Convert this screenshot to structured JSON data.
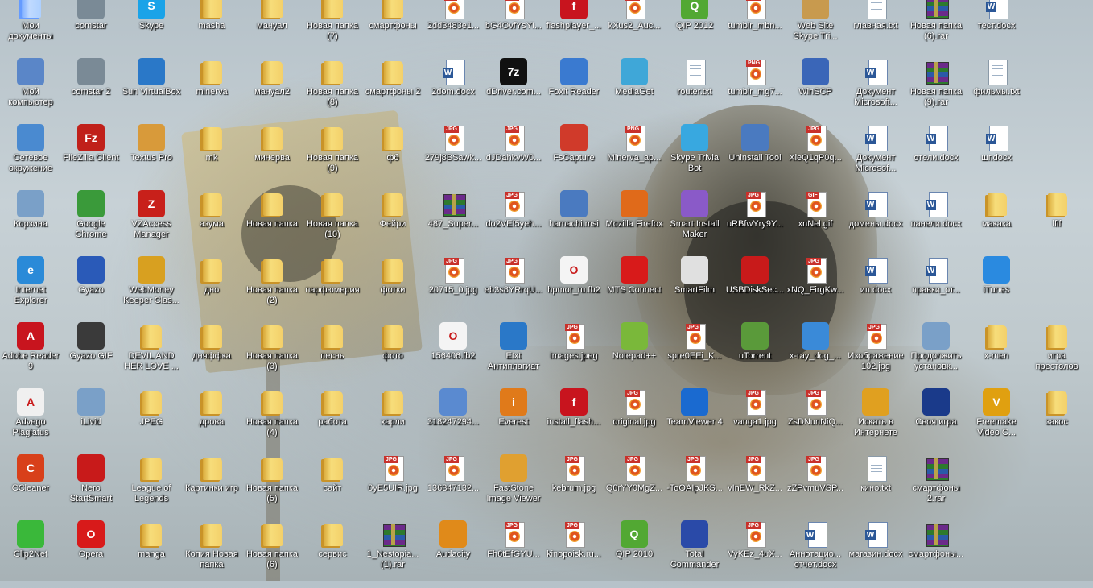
{
  "desktop": {
    "items": [
      {
        "label": "Мои документы",
        "icon": "my-documents-icon",
        "glyph": "folder",
        "color": "#4a7fd4"
      },
      {
        "label": "comstar",
        "icon": "shortcut-pc-icon",
        "glyph": "app",
        "color": "#7a8a96"
      },
      {
        "label": "Skype",
        "icon": "skype-icon",
        "glyph": "app",
        "color": "#1aa3e8",
        "sym": "S"
      },
      {
        "label": "masha",
        "icon": "folder-icon",
        "glyph": "folder"
      },
      {
        "label": "мануал",
        "icon": "folder-icon",
        "glyph": "folder"
      },
      {
        "label": "Новая папка (7)",
        "icon": "folder-icon",
        "glyph": "folder"
      },
      {
        "label": "смартфоны",
        "icon": "folder-icon",
        "glyph": "folder"
      },
      {
        "label": "2dd3483e1...",
        "icon": "gif-file-icon",
        "glyph": "img",
        "tag": "GIF"
      },
      {
        "label": "bG4OvfYsYI...",
        "icon": "jpg-file-icon",
        "glyph": "img",
        "tag": "JPG"
      },
      {
        "label": "flashplayer_...",
        "icon": "flash-icon",
        "glyph": "app",
        "color": "#c8141e",
        "sym": "f"
      },
      {
        "label": "kXus2_Auc...",
        "icon": "jpg-file-icon",
        "glyph": "img",
        "tag": "JPG"
      },
      {
        "label": "QIP 2012",
        "icon": "qip-icon",
        "glyph": "app",
        "color": "#52a833",
        "sym": "Q"
      },
      {
        "label": "tumblr_mbn...",
        "icon": "jpg-file-icon",
        "glyph": "img",
        "tag": "JPG"
      },
      {
        "label": "Web Site Skype Tri...",
        "icon": "package-icon",
        "glyph": "app",
        "color": "#c89a4e"
      },
      {
        "label": "главная.txt",
        "icon": "text-file-icon",
        "glyph": "doc"
      },
      {
        "label": "Новая папка (6).rar",
        "icon": "rar-archive-icon",
        "glyph": "rar"
      },
      {
        "label": "тест.docx",
        "icon": "word-doc-icon",
        "glyph": "word"
      },
      {
        "label": "Мой компьютер",
        "icon": "my-computer-icon",
        "glyph": "app",
        "color": "#5a86c8"
      },
      {
        "label": "comstar 2",
        "icon": "shortcut-pc-icon",
        "glyph": "app",
        "color": "#7a8a96"
      },
      {
        "label": "Sun VirtualBox",
        "icon": "virtualbox-icon",
        "glyph": "app",
        "color": "#2a78c8"
      },
      {
        "label": "minerva",
        "icon": "folder-icon",
        "glyph": "folder"
      },
      {
        "label": "мануал2",
        "icon": "folder-icon",
        "glyph": "folder"
      },
      {
        "label": "Новая папка (8)",
        "icon": "folder-icon",
        "glyph": "folder"
      },
      {
        "label": "смартфоны 2",
        "icon": "folder-icon",
        "glyph": "folder"
      },
      {
        "label": "2dom.docx",
        "icon": "word-doc-icon",
        "glyph": "word"
      },
      {
        "label": "dDriver.com...",
        "icon": "7zip-icon",
        "glyph": "app",
        "color": "#111",
        "sym": "7z"
      },
      {
        "label": "Foxit Reader",
        "icon": "foxit-reader-icon",
        "glyph": "app",
        "color": "#3a7ad0"
      },
      {
        "label": "MediaGet",
        "icon": "mediaget-icon",
        "glyph": "app",
        "color": "#3fa7d8"
      },
      {
        "label": "router.txt",
        "icon": "text-file-icon",
        "glyph": "doc"
      },
      {
        "label": "tumblr_mg7...",
        "icon": "png-file-icon",
        "glyph": "img",
        "tag": "PNG"
      },
      {
        "label": "WinSCP",
        "icon": "winscp-icon",
        "glyph": "app",
        "color": "#3a66b8"
      },
      {
        "label": "Документ Microsoft...",
        "icon": "word-doc-icon",
        "glyph": "word"
      },
      {
        "label": "Новая папка (9).rar",
        "icon": "rar-archive-icon",
        "glyph": "rar"
      },
      {
        "label": "фильмы.txt",
        "icon": "text-file-icon",
        "glyph": "doc"
      },
      {
        "label": "Сетевое окружение",
        "icon": "network-icon",
        "glyph": "app",
        "color": "#4a8ad0"
      },
      {
        "label": "FileZilla Client",
        "icon": "filezilla-icon",
        "glyph": "app",
        "color": "#c0201a",
        "sym": "Fz"
      },
      {
        "label": "Textus Pro",
        "icon": "key-icon",
        "glyph": "app",
        "color": "#d89a3a"
      },
      {
        "label": "mk",
        "icon": "folder-icon",
        "glyph": "folder"
      },
      {
        "label": "минерва",
        "icon": "folder-icon",
        "glyph": "folder"
      },
      {
        "label": "Новая папка (9)",
        "icon": "folder-icon",
        "glyph": "folder"
      },
      {
        "label": "фб",
        "icon": "folder-icon",
        "glyph": "folder"
      },
      {
        "label": "279j8BSawk...",
        "icon": "jpg-file-icon",
        "glyph": "img",
        "tag": "JPG"
      },
      {
        "label": "dJDahkvW0...",
        "icon": "jpg-file-icon",
        "glyph": "img",
        "tag": "JPG"
      },
      {
        "label": "FsCapture",
        "icon": "fscapture-icon",
        "glyph": "app",
        "color": "#d03a2a"
      },
      {
        "label": "Minerva_ap...",
        "icon": "png-file-icon",
        "glyph": "img",
        "tag": "PNG"
      },
      {
        "label": "Skype Trivia Bot",
        "icon": "skype-trivia-icon",
        "glyph": "app",
        "color": "#38a8e0"
      },
      {
        "label": "Uninstall Tool",
        "icon": "uninstall-tool-icon",
        "glyph": "app",
        "color": "#4a7ac0"
      },
      {
        "label": "XieQ1qP0q...",
        "icon": "jpg-file-icon",
        "glyph": "img",
        "tag": "JPG"
      },
      {
        "label": "Документ Microsof...",
        "icon": "word-doc-icon",
        "glyph": "word"
      },
      {
        "label": "отели.docx",
        "icon": "word-doc-icon",
        "glyph": "word"
      },
      {
        "label": "шг.docx",
        "icon": "word-doc-icon",
        "glyph": "word"
      },
      {
        "label": "Корзина",
        "icon": "recycle-bin-icon",
        "glyph": "app",
        "color": "#7aa0c8"
      },
      {
        "label": "Google Chrome",
        "icon": "chrome-icon",
        "glyph": "app",
        "color": "#3a9a3a"
      },
      {
        "label": "VZAccess Manager",
        "icon": "vzaccess-icon",
        "glyph": "app",
        "color": "#c8201a",
        "sym": "Z"
      },
      {
        "label": "азума",
        "icon": "folder-icon",
        "glyph": "folder"
      },
      {
        "label": "Новая папка",
        "icon": "folder-icon",
        "glyph": "folder"
      },
      {
        "label": "Новая папка (10)",
        "icon": "folder-icon",
        "glyph": "folder"
      },
      {
        "label": "Фейри",
        "icon": "folder-icon",
        "glyph": "folder"
      },
      {
        "label": "487_Super...",
        "icon": "rar-archive-icon",
        "glyph": "rar"
      },
      {
        "label": "do2VEf5yeh...",
        "icon": "jpg-file-icon",
        "glyph": "img",
        "tag": "JPG"
      },
      {
        "label": "hamachi.msi",
        "icon": "installer-icon",
        "glyph": "app",
        "color": "#4a7ac0"
      },
      {
        "label": "Mozilla Firefox",
        "icon": "firefox-icon",
        "glyph": "app",
        "color": "#e06a1a"
      },
      {
        "label": "Smart Install Maker",
        "icon": "install-maker-icon",
        "glyph": "app",
        "color": "#8a5ac8"
      },
      {
        "label": "uRBfwYry9Y...",
        "icon": "jpg-file-icon",
        "glyph": "img",
        "tag": "JPG"
      },
      {
        "label": "xnNel.gif",
        "icon": "gif-file-icon",
        "glyph": "img",
        "tag": "GIF"
      },
      {
        "label": "домены.docx",
        "icon": "word-doc-icon",
        "glyph": "word"
      },
      {
        "label": "панели.docx",
        "icon": "word-doc-icon",
        "glyph": "word"
      },
      {
        "label": "макака",
        "icon": "folder-icon",
        "glyph": "folder"
      },
      {
        "label": "lfif",
        "icon": "folder-icon",
        "glyph": "folder"
      },
      {
        "label": "Internet Explorer",
        "icon": "internet-explorer-icon",
        "glyph": "app",
        "color": "#2a8ad8",
        "sym": "e"
      },
      {
        "label": "Gyazo",
        "icon": "gyazo-icon",
        "glyph": "app",
        "color": "#2a5ab8"
      },
      {
        "label": "WebMoney Keeper Clas...",
        "icon": "webmoney-icon",
        "glyph": "app",
        "color": "#d8a020"
      },
      {
        "label": "дно",
        "icon": "folder-icon",
        "glyph": "folder"
      },
      {
        "label": "Новая папка (2)",
        "icon": "folder-icon",
        "glyph": "folder"
      },
      {
        "label": "парфюмерия",
        "icon": "folder-icon",
        "glyph": "folder"
      },
      {
        "label": "фотки",
        "icon": "folder-icon",
        "glyph": "folder"
      },
      {
        "label": "20715_0.jpg",
        "icon": "jpg-file-icon",
        "glyph": "img",
        "tag": "JPG"
      },
      {
        "label": "eb3s8YRrqU...",
        "icon": "jpg-file-icon",
        "glyph": "img",
        "tag": "JPG"
      },
      {
        "label": "hpmor_ru.fb2",
        "icon": "fb2-file-icon",
        "glyph": "app",
        "color": "#f4f4f4",
        "sym": "O"
      },
      {
        "label": "MTS Connect",
        "icon": "mts-connect-icon",
        "glyph": "app",
        "color": "#d81a1a"
      },
      {
        "label": "SmartFilm",
        "icon": "smartfilm-icon",
        "glyph": "app",
        "color": "#e0e0e0"
      },
      {
        "label": "USBDiskSec...",
        "icon": "usb-disk-security-icon",
        "glyph": "app",
        "color": "#c81a1a"
      },
      {
        "label": "xNQ_FirgKw...",
        "icon": "jpg-file-icon",
        "glyph": "img",
        "tag": "JPG"
      },
      {
        "label": "ип.docx",
        "icon": "word-doc-icon",
        "glyph": "word"
      },
      {
        "label": "правки_от...",
        "icon": "word-doc-icon",
        "glyph": "word"
      },
      {
        "label": "iTunes",
        "icon": "itunes-icon",
        "glyph": "app",
        "color": "#2a8ae0"
      },
      {
        "label": "Adobe Reader 9",
        "icon": "adobe-reader-icon",
        "glyph": "app",
        "color": "#c8141e",
        "sym": "A"
      },
      {
        "label": "Gyazo GIF",
        "icon": "gyazo-gif-icon",
        "glyph": "app",
        "color": "#3a3a3a"
      },
      {
        "label": "DEVIL AND HER LOVE ...",
        "icon": "folder-icon",
        "glyph": "folder"
      },
      {
        "label": "дняффка",
        "icon": "folder-icon",
        "glyph": "folder"
      },
      {
        "label": "Новая папка (3)",
        "icon": "folder-icon",
        "glyph": "folder"
      },
      {
        "label": "песнь",
        "icon": "folder-icon",
        "glyph": "folder"
      },
      {
        "label": "фото",
        "icon": "folder-icon",
        "glyph": "folder"
      },
      {
        "label": "156406.fb2",
        "icon": "fb2-file-icon",
        "glyph": "app",
        "color": "#f4f4f4",
        "sym": "O"
      },
      {
        "label": "Etxt Антиплагиат",
        "icon": "etxt-icon",
        "glyph": "app",
        "color": "#2a78c8"
      },
      {
        "label": "images.jpeg",
        "icon": "jpg-file-icon",
        "glyph": "img",
        "tag": "JPG"
      },
      {
        "label": "Notepad++",
        "icon": "notepad-plus-icon",
        "glyph": "app",
        "color": "#7ab83a"
      },
      {
        "label": "spre0EEi_K...",
        "icon": "jpg-file-icon",
        "glyph": "img",
        "tag": "JPG"
      },
      {
        "label": "uTorrent",
        "icon": "utorrent-icon",
        "glyph": "app",
        "color": "#5a9a3a"
      },
      {
        "label": "x-ray_dog_...",
        "icon": "video-file-icon",
        "glyph": "app",
        "color": "#3a8ad8"
      },
      {
        "label": "Изображение 102.jpg",
        "icon": "jpg-file-icon",
        "glyph": "img",
        "tag": "JPG"
      },
      {
        "label": "Продолжить установк...",
        "icon": "setup-icon",
        "glyph": "app",
        "color": "#7aa0c8"
      },
      {
        "label": "x-men",
        "icon": "folder-icon",
        "glyph": "folder"
      },
      {
        "label": "игра престолов",
        "icon": "folder-icon",
        "glyph": "folder"
      },
      {
        "label": "Advego Plagiatus",
        "icon": "advego-icon",
        "glyph": "app",
        "color": "#f0f0f0",
        "sym": "A"
      },
      {
        "label": "iLivid",
        "icon": "ilivid-icon",
        "glyph": "app",
        "color": "#7aa0c8"
      },
      {
        "label": "JPEG",
        "icon": "folder-icon",
        "glyph": "folder"
      },
      {
        "label": "дрова",
        "icon": "folder-icon",
        "glyph": "folder"
      },
      {
        "label": "Новая папка (4)",
        "icon": "folder-icon",
        "glyph": "folder"
      },
      {
        "label": "работа",
        "icon": "folder-icon",
        "glyph": "folder"
      },
      {
        "label": "харли",
        "icon": "folder-icon",
        "glyph": "folder"
      },
      {
        "label": "318247294...",
        "icon": "windows-file-icon",
        "glyph": "app",
        "color": "#5a8ad0"
      },
      {
        "label": "Everest",
        "icon": "everest-icon",
        "glyph": "app",
        "color": "#e07a1a",
        "sym": "i"
      },
      {
        "label": "install_flash...",
        "icon": "flash-icon",
        "glyph": "app",
        "color": "#c8141e",
        "sym": "f"
      },
      {
        "label": "original.jpg",
        "icon": "jpg-file-icon",
        "glyph": "img",
        "tag": "JPG"
      },
      {
        "label": "TeamViewer 4",
        "icon": "teamviewer-icon",
        "glyph": "app",
        "color": "#1a6ad0"
      },
      {
        "label": "vanga1.jpg",
        "icon": "jpg-file-icon",
        "glyph": "img",
        "tag": "JPG"
      },
      {
        "label": "ZsDNunNiQ...",
        "icon": "jpg-file-icon",
        "glyph": "img",
        "tag": "JPG"
      },
      {
        "label": "Искать в Интернете",
        "icon": "search-web-icon",
        "glyph": "app",
        "color": "#e0a020"
      },
      {
        "label": "Своя игра",
        "icon": "svoya-igra-icon",
        "glyph": "app",
        "color": "#1a3a8a"
      },
      {
        "label": "Freemake Video C...",
        "icon": "freemake-icon",
        "glyph": "app",
        "color": "#e0a010",
        "sym": "V"
      },
      {
        "label": "закос",
        "icon": "folder-icon",
        "glyph": "folder"
      },
      {
        "label": "CCleaner",
        "icon": "ccleaner-icon",
        "glyph": "app",
        "color": "#d8401a",
        "sym": "C"
      },
      {
        "label": "Nero StartSmart",
        "icon": "nero-icon",
        "glyph": "app",
        "color": "#c81a1a"
      },
      {
        "label": "League of Legends",
        "icon": "folder-icon",
        "glyph": "folder"
      },
      {
        "label": "Картинки игр",
        "icon": "folder-icon",
        "glyph": "folder"
      },
      {
        "label": "Новая папка (5)",
        "icon": "folder-icon",
        "glyph": "folder"
      },
      {
        "label": "сайт",
        "icon": "folder-icon",
        "glyph": "folder"
      },
      {
        "label": "0yE5UIR.jpg",
        "icon": "jpg-file-icon",
        "glyph": "img",
        "tag": "JPG"
      },
      {
        "label": "136347132...",
        "icon": "jpg-file-icon",
        "glyph": "img",
        "tag": "JPG"
      },
      {
        "label": "FastStone Image Viewer",
        "icon": "faststone-icon",
        "glyph": "app",
        "color": "#e0a030"
      },
      {
        "label": "kebrum.jpg",
        "icon": "jpg-file-icon",
        "glyph": "img",
        "tag": "JPG"
      },
      {
        "label": "Q0rYY0MgZ...",
        "icon": "jpg-file-icon",
        "glyph": "img",
        "tag": "JPG"
      },
      {
        "label": "-ToOAIpJKS...",
        "icon": "jpg-file-icon",
        "glyph": "img",
        "tag": "JPG"
      },
      {
        "label": "vInEW_RkZ...",
        "icon": "jpg-file-icon",
        "glyph": "img",
        "tag": "JPG"
      },
      {
        "label": "zZPvmuVSP...",
        "icon": "jpg-file-icon",
        "glyph": "img",
        "tag": "JPG"
      },
      {
        "label": "кино.txt",
        "icon": "text-file-icon",
        "glyph": "doc"
      },
      {
        "label": "смартфоны 2.rar",
        "icon": "rar-archive-icon",
        "glyph": "rar"
      },
      {
        "label": "Clip2Net",
        "icon": "clip2net-icon",
        "glyph": "app",
        "color": "#3ab83a"
      },
      {
        "label": "Opera",
        "icon": "opera-icon",
        "glyph": "app",
        "color": "#d81a1a",
        "sym": "O"
      },
      {
        "label": "manga",
        "icon": "folder-icon",
        "glyph": "folder"
      },
      {
        "label": "Копия Новая папка",
        "icon": "folder-icon",
        "glyph": "folder"
      },
      {
        "label": "Новая папка (6)",
        "icon": "folder-icon",
        "glyph": "folder"
      },
      {
        "label": "сервис",
        "icon": "folder-icon",
        "glyph": "folder"
      },
      {
        "label": "1_Nestopia... (1).rar",
        "icon": "rar-archive-icon",
        "glyph": "rar"
      },
      {
        "label": "Audacity",
        "icon": "audacity-icon",
        "glyph": "app",
        "color": "#e08a1a"
      },
      {
        "label": "Fh6tEfGYU...",
        "icon": "jpg-file-icon",
        "glyph": "img",
        "tag": "JPG"
      },
      {
        "label": "kinopoisk.ru...",
        "icon": "jpg-file-icon",
        "glyph": "img",
        "tag": "JPG"
      },
      {
        "label": "QIP 2010",
        "icon": "qip-icon",
        "glyph": "app",
        "color": "#52a833",
        "sym": "Q"
      },
      {
        "label": "Total Commander",
        "icon": "total-commander-icon",
        "glyph": "app",
        "color": "#2a4aa8"
      },
      {
        "label": "VyKEz_4uX...",
        "icon": "jpg-file-icon",
        "glyph": "img",
        "tag": "JPG"
      },
      {
        "label": "Аннотацио... отчет.docx",
        "icon": "word-doc-icon",
        "glyph": "word"
      },
      {
        "label": "магазин.docx",
        "icon": "word-doc-icon",
        "glyph": "word"
      },
      {
        "label": "смартфоны...",
        "icon": "rar-archive-icon",
        "glyph": "rar"
      }
    ]
  }
}
